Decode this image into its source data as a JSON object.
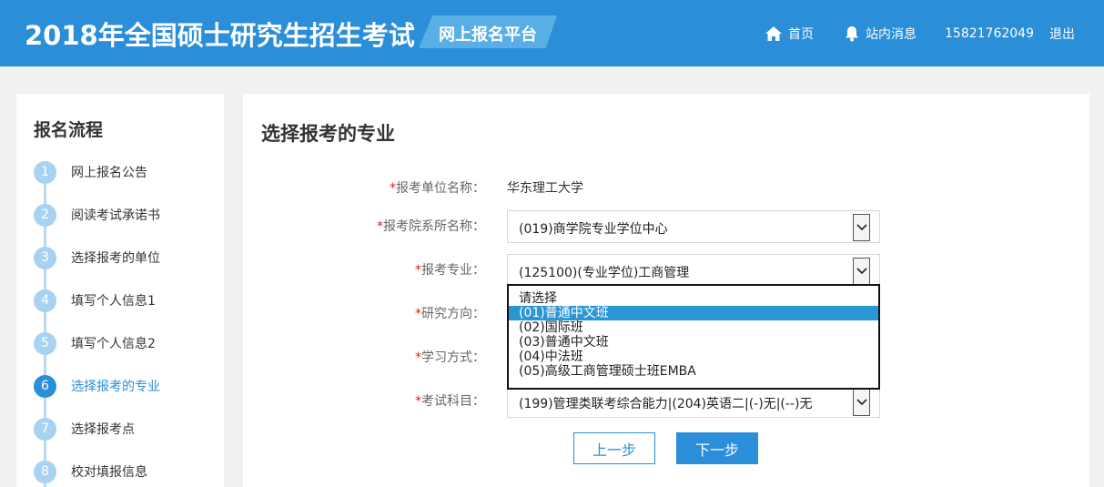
{
  "header": {
    "title": "2018年全国硕士研究生招生考试",
    "platform": "网上报名平台",
    "nav_home": "首页",
    "nav_messages": "站内消息",
    "nav_phone": "15821762049",
    "nav_logout": "退出"
  },
  "sidebar": {
    "title": "报名流程",
    "steps": [
      {
        "num": "1",
        "label": "网上报名公告"
      },
      {
        "num": "2",
        "label": "阅读考试承诺书"
      },
      {
        "num": "3",
        "label": "选择报考的单位"
      },
      {
        "num": "4",
        "label": "填写个人信息1"
      },
      {
        "num": "5",
        "label": "填写个人信息2"
      },
      {
        "num": "6",
        "label": "选择报考的专业"
      },
      {
        "num": "7",
        "label": "选择报考点"
      },
      {
        "num": "8",
        "label": "校对填报信息"
      }
    ],
    "active_step": "6"
  },
  "main": {
    "title": "选择报考的专业",
    "fields": {
      "unit": {
        "label": "报考单位名称：",
        "value": "华东理工大学"
      },
      "department": {
        "label": "报考院系所名称：",
        "value": "(019)商学院专业学位中心"
      },
      "major": {
        "label": "报考专业：",
        "value": "(125100)(专业学位)工商管理"
      },
      "direction": {
        "label": "研究方向："
      },
      "study_mode": {
        "label": "学习方式："
      },
      "subjects": {
        "label": "考试科目：",
        "value": "(199)管理类联考综合能力|(204)英语二|(-)无|(--)无"
      }
    },
    "required_mark": "*",
    "dropdown": {
      "options": [
        "请选择",
        "(01)普通中文班",
        "(02)国际班",
        "(03)普通中文班",
        "(04)中法班",
        "(05)高级工商管理硕士班EMBA"
      ],
      "highlighted": "(01)普通中文班"
    },
    "buttons": {
      "prev": "上一步",
      "next": "下一步"
    }
  },
  "colors": {
    "primary": "#2a8ed8",
    "step_inactive": "#a8d3f0",
    "required": "#e02020"
  }
}
